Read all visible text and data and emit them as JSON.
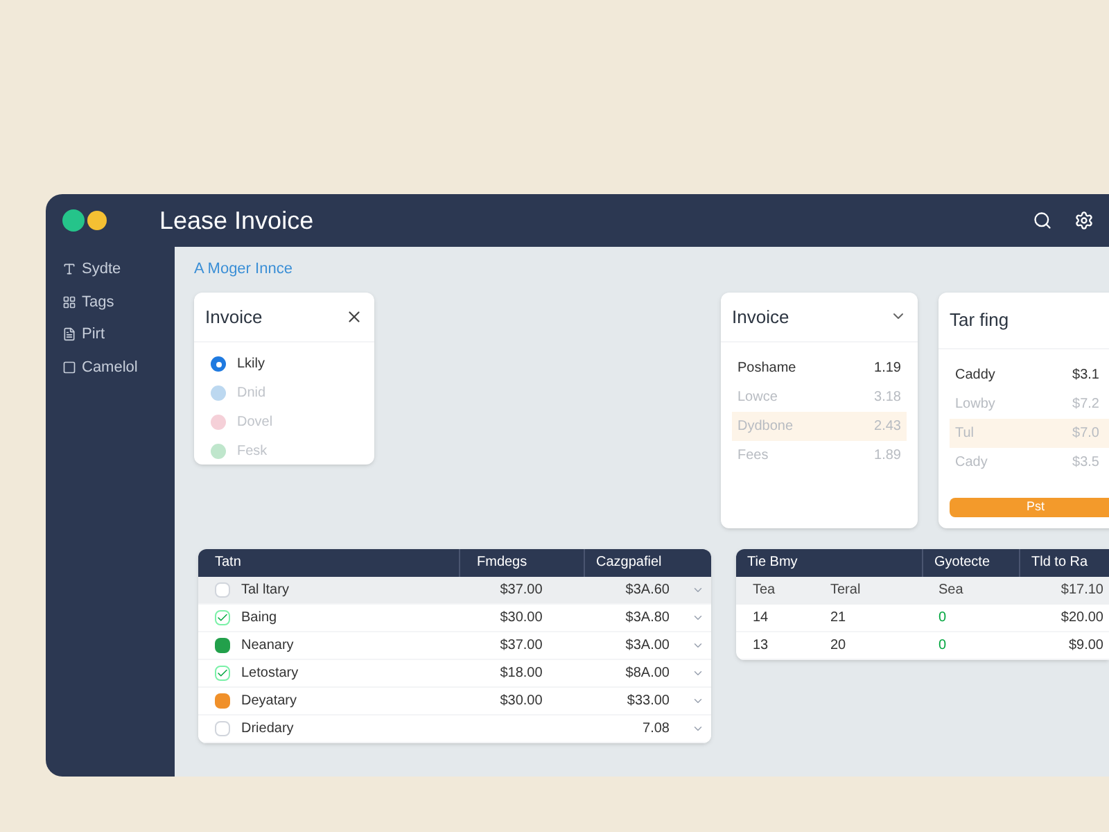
{
  "window": {
    "title": "Lease Invoice"
  },
  "sidebar": {
    "items": [
      {
        "label": "Sydte"
      },
      {
        "label": "Tags"
      },
      {
        "label": "Pirt"
      },
      {
        "label": "Camelol"
      }
    ]
  },
  "breadcrumb": "A Moger Innce",
  "invoice_panel": {
    "title": "Invoice",
    "options": [
      {
        "label": "Lkily",
        "color": "#1f7ae0",
        "selected": true
      },
      {
        "label": "Dnid",
        "color": "#bcd8f0",
        "selected": false
      },
      {
        "label": "Dovel",
        "color": "#f5d0d8",
        "selected": false
      },
      {
        "label": "Fesk",
        "color": "#bfe6cc",
        "selected": false
      }
    ]
  },
  "invoice_card": {
    "title": "Invoice",
    "rows": [
      {
        "label": "Poshame",
        "value": "1.19",
        "selected": false
      },
      {
        "label": "Lowce",
        "value": "3.18",
        "selected": false
      },
      {
        "label": "Dydbone",
        "value": "2.43",
        "selected": true
      },
      {
        "label": "Fees",
        "value": "1.89",
        "selected": false
      }
    ]
  },
  "tar_card": {
    "title": "Tar fing",
    "rows": [
      {
        "label": "Caddy",
        "value": "$3.1",
        "selected": false
      },
      {
        "label": "Lowby",
        "value": "$7.2",
        "selected": false
      },
      {
        "label": "Tul",
        "value": "$7.0",
        "selected": true
      },
      {
        "label": "Cady",
        "value": "$3.5",
        "selected": false
      }
    ],
    "button": "Pst"
  },
  "items_table": {
    "columns": [
      "Tatn",
      "Fmdegs",
      "Cazgpafiel"
    ],
    "rows": [
      {
        "kind": "blank",
        "name": "Tal ltary",
        "price": "$37.00",
        "total": "$3A.60",
        "selected": true
      },
      {
        "kind": "tick",
        "name": "Baing",
        "price": "$30.00",
        "total": "$3A.80",
        "selected": false
      },
      {
        "kind": "square",
        "color": "#22a04b",
        "name": "Neanary",
        "price": "$37.00",
        "total": "$3A.00",
        "selected": false
      },
      {
        "kind": "tick",
        "name": "Letostary",
        "price": "$18.00",
        "total": "$8A.00",
        "selected": false
      },
      {
        "kind": "square",
        "color": "#f0902a",
        "name": "Deyatary",
        "price": "$30.00",
        "total": "$33.00",
        "selected": false
      },
      {
        "kind": "blank",
        "name": "Driedary",
        "price": "",
        "total": "7.08",
        "selected": false
      }
    ]
  },
  "summary_table": {
    "columns": [
      "Tie Bmy",
      "",
      "Gyotecte",
      "Tld to Ra"
    ],
    "subheader": [
      "Tea",
      "Teral",
      "Sea",
      "$17.10"
    ],
    "rows": [
      [
        "14",
        "21",
        "0",
        "$20.00"
      ],
      [
        "13",
        "20",
        "0",
        "$9.00"
      ]
    ]
  }
}
